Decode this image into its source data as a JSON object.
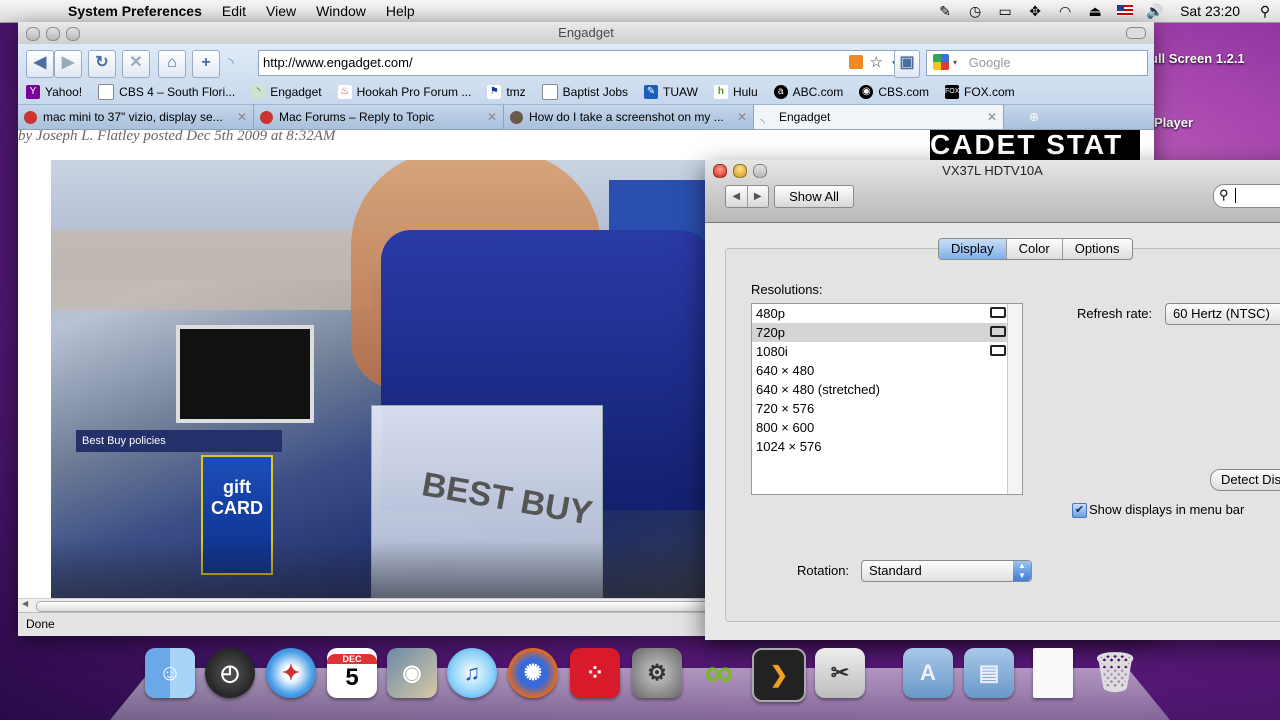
{
  "menubar": {
    "app_name": "System Preferences",
    "items": [
      "Edit",
      "View",
      "Window",
      "Help"
    ],
    "clock": "Sat 23:20",
    "apple_glyph": ""
  },
  "desktop": {
    "text1": "ull Screen 1.2.1",
    "text2": "Player"
  },
  "browser": {
    "title": "Engadget",
    "url": "http://www.engadget.com/",
    "search_placeholder": "Google",
    "bookmarks": [
      "Yahoo!",
      "CBS 4 – South Flori...",
      "Engadget",
      "Hookah Pro Forum ...",
      "tmz",
      "Baptist Jobs",
      "TUAW",
      "Hulu",
      "ABC.com",
      "CBS.com",
      "FOX.com"
    ],
    "tabs": [
      {
        "label": "mac mini to 37\" vizio, display se..."
      },
      {
        "label": "Mac Forums – Reply to Topic"
      },
      {
        "label": "How do I take a screenshot on my ..."
      },
      {
        "label": "Engadget"
      }
    ],
    "byline": "by Joseph L. Flatley posted Dec 5th 2009 at 8:32AM",
    "photo_sign": "Best Buy policies",
    "photo_card": "gift CARD",
    "photo_bag": "BEST BUY",
    "status": "Done",
    "ad_text": "CADET STAT"
  },
  "prefs": {
    "title": "VX37L HDTV10A",
    "show_all": "Show All",
    "tabs": [
      "Display",
      "Color",
      "Options"
    ],
    "active_tab": "Display",
    "resolutions_label": "Resolutions:",
    "resolutions": [
      {
        "label": "480p",
        "tv": true
      },
      {
        "label": "720p",
        "tv": true
      },
      {
        "label": "1080i",
        "tv": true
      },
      {
        "label": "640 × 480",
        "tv": false
      },
      {
        "label": "640 × 480 (stretched)",
        "tv": false
      },
      {
        "label": "720 × 576",
        "tv": false
      },
      {
        "label": "800 × 600",
        "tv": false
      },
      {
        "label": "1024 × 576",
        "tv": false
      }
    ],
    "selected_resolution": "720p",
    "refresh_label": "Refresh rate:",
    "refresh_value": "60 Hertz (NTSC)",
    "detect_label": "Detect Dis",
    "show_menu_label": "Show displays in menu bar",
    "show_menu_checked": true,
    "rotation_label": "Rotation:",
    "rotation_value": "Standard"
  },
  "dock": {
    "icons": [
      "finder-icon",
      "dashboard-icon",
      "safari-icon",
      "ical-icon",
      "iphoto-icon",
      "itunes-icon",
      "firefox-icon",
      "boxee-icon",
      "system-preferences-icon",
      "vuze-icon",
      "plex-icon",
      "grab-icon",
      "applications-folder-icon",
      "documents-folder-icon",
      "file-icon",
      "trash-icon"
    ],
    "ical_month": "DEC",
    "ical_day": "5"
  }
}
